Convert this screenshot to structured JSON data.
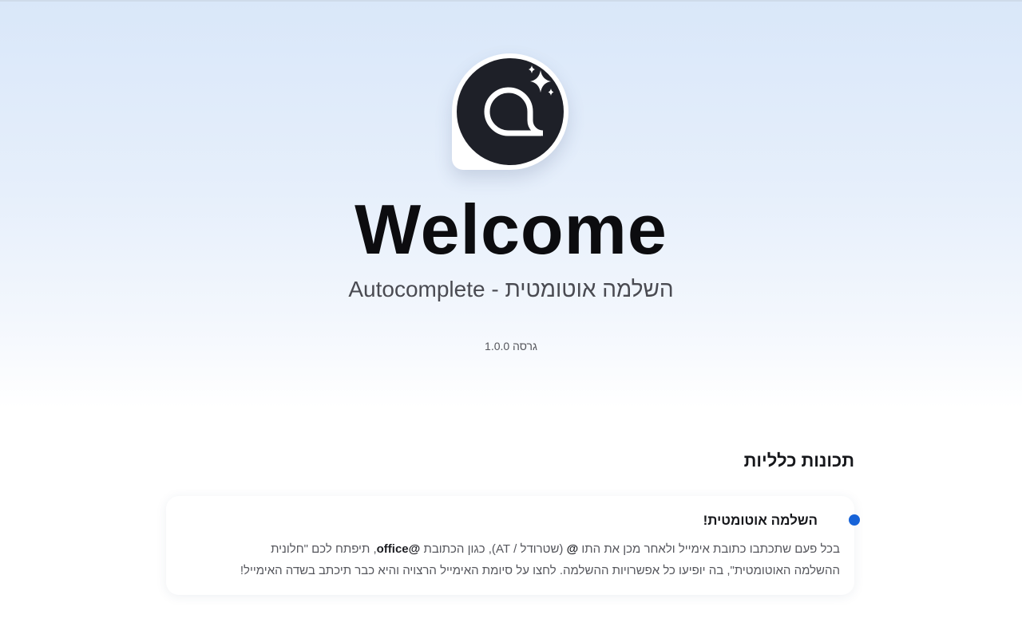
{
  "header": {
    "title": "Welcome",
    "subtitle": "השלמה אוטומטית - Autocomplete",
    "version": "גרסה 1.0.0",
    "logo_icon": "at-sign-sparkle-icon"
  },
  "features": {
    "section_title": "תכונות כלליות",
    "items": [
      {
        "title": "השלמה אוטומטית!",
        "body_1": "בכל פעם שתכתבו כתובת אימייל ולאחר מכן את התו ",
        "body_at": "@",
        "body_2": " (שטרודל / AT), כגון הכתובת ",
        "body_office": "office@",
        "body_3": ", תיפתח לכם \"חלונית ההשלמה האוטומטית\", בה יופיעו כל אפשרויות ההשלמה. לחצו על סיומת האימייל הרצויה והיא כבר תיכתב בשדה האימייל!",
        "bullet_color": "#1763d8"
      }
    ]
  },
  "colors": {
    "accent": "#1763d8",
    "logo_dark": "#1e2028",
    "background_top": "#d9e7f9"
  }
}
